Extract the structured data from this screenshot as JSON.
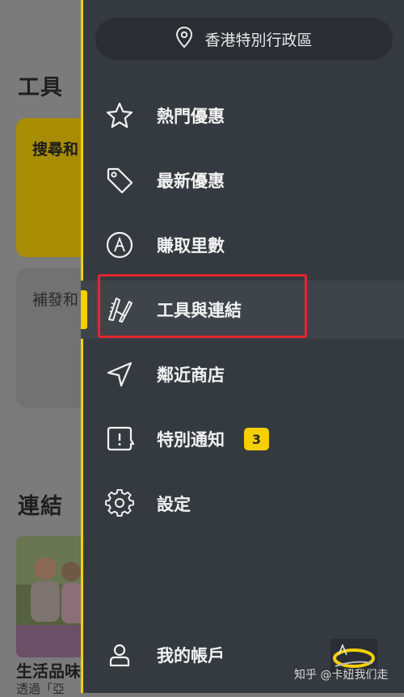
{
  "background": {
    "tools_heading": "工具",
    "links_heading": "連結",
    "card_search_label": "搜尋和",
    "card_replace_label": "補發和",
    "photo_title": "生活品味",
    "photo_subtitle": "透過「亞"
  },
  "drawer": {
    "region": "香港特別行政區",
    "items": [
      {
        "label": "熱門優惠",
        "icon": "star-icon"
      },
      {
        "label": "最新優惠",
        "icon": "tag-icon"
      },
      {
        "label": "賺取里數",
        "icon": "asia-miles-icon"
      },
      {
        "label": "工具與連結",
        "icon": "tools-icon",
        "active": true
      },
      {
        "label": "鄰近商店",
        "icon": "navigation-arrow-icon"
      },
      {
        "label": "特別通知",
        "icon": "notification-icon",
        "badge": "3"
      },
      {
        "label": "設定",
        "icon": "gear-icon"
      },
      {
        "label": "我的帳戶",
        "icon": "user-icon"
      }
    ]
  },
  "watermark": "知乎 @卡妞我们走",
  "colors": {
    "drawer": "#353a40",
    "accent": "#f4d000",
    "highlight": "#e3262f"
  }
}
